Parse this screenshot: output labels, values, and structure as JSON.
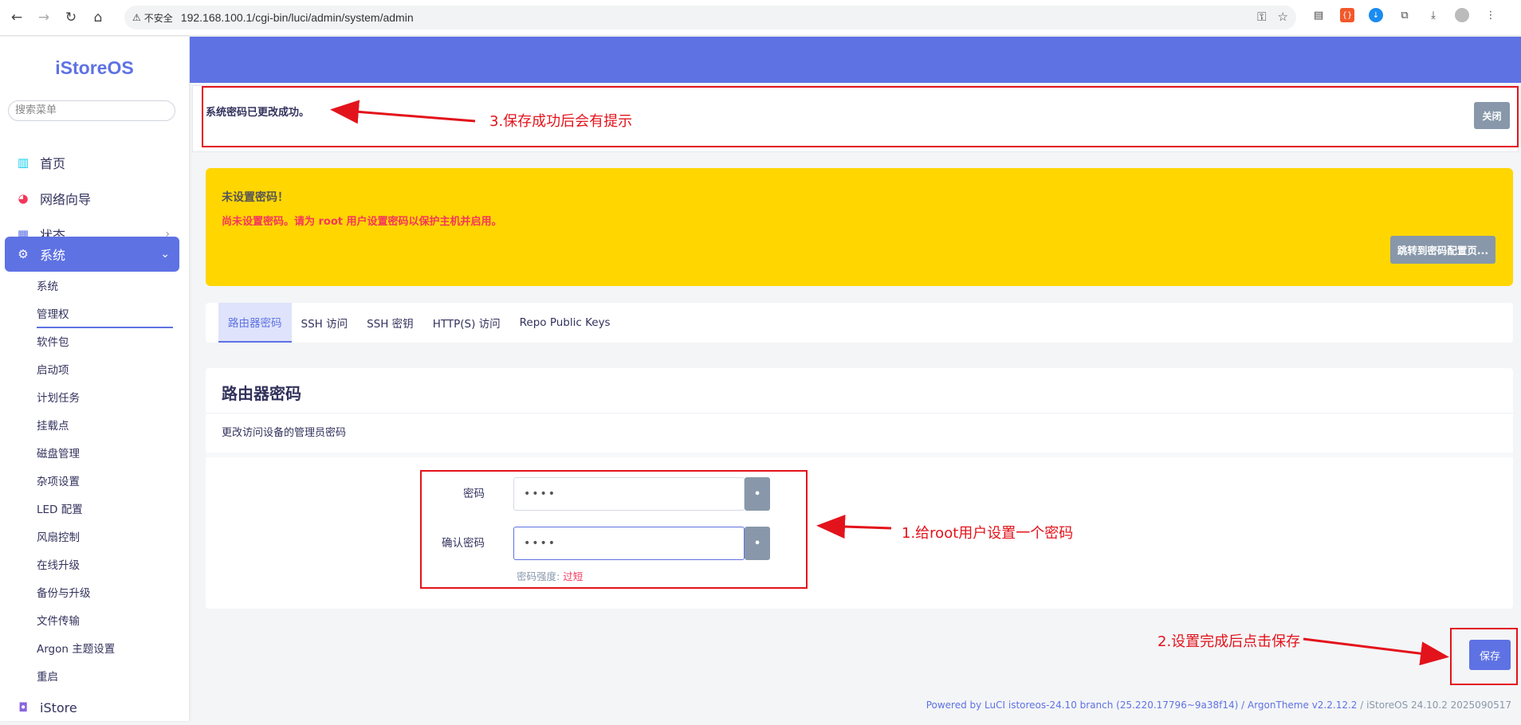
{
  "browser": {
    "insecure_label": "不安全",
    "url": "192.168.100.1/cgi-bin/luci/admin/system/admin"
  },
  "sidebar": {
    "brand": "iStoreOS",
    "search_placeholder": "搜索菜单",
    "top_items": [
      {
        "label": "首页",
        "icon": "chart-icon"
      },
      {
        "label": "网络向导",
        "icon": "globe-icon"
      },
      {
        "label": "状态",
        "icon": "grid-icon"
      },
      {
        "label": "系统",
        "icon": "gear-icon"
      }
    ],
    "sub_items": [
      "系统",
      "管理权",
      "软件包",
      "启动项",
      "计划任务",
      "挂载点",
      "磁盘管理",
      "杂项设置",
      "LED 配置",
      "风扇控制",
      "在线升级",
      "备份与升级",
      "文件传输",
      "Argon 主题设置",
      "重启"
    ],
    "bottom_item": "iStore"
  },
  "alert_success": {
    "message": "系统密码已更改成功。",
    "close_label": "关闭"
  },
  "alert_warning": {
    "title": "未设置密码！",
    "message": "尚未设置密码。请为 root 用户设置密码以保护主机并启用。",
    "button_label": "跳转到密码配置页..."
  },
  "tabs": [
    "路由器密码",
    "SSH 访问",
    "SSH 密钥",
    "HTTP(S) 访问",
    "Repo Public Keys"
  ],
  "panel": {
    "title": "路由器密码",
    "description": "更改访问设备的管理员密码",
    "password_label": "密码",
    "password_value": "••••",
    "confirm_label": "确认密码",
    "confirm_value": "••••",
    "reveal_symbol": "•",
    "strength_label": "密码强度: ",
    "strength_value": "过短"
  },
  "save_label": "保存",
  "footer": {
    "text": "Powered by LuCI istoreos-24.10 branch (25.220.17796~9a38f14) / ArgonTheme v2.2.12.2",
    "suffix": " / iStoreOS 24.10.2 2025090517"
  },
  "annotations": {
    "note1": "1.给root用户设置一个密码",
    "note2": "2.设置完成后点击保存",
    "note3": "3.保存成功后会有提示"
  },
  "colors": {
    "accent": "#5e72e4",
    "warning": "#ffd600",
    "danger": "#f5365c",
    "annotation": "#e3131b"
  }
}
